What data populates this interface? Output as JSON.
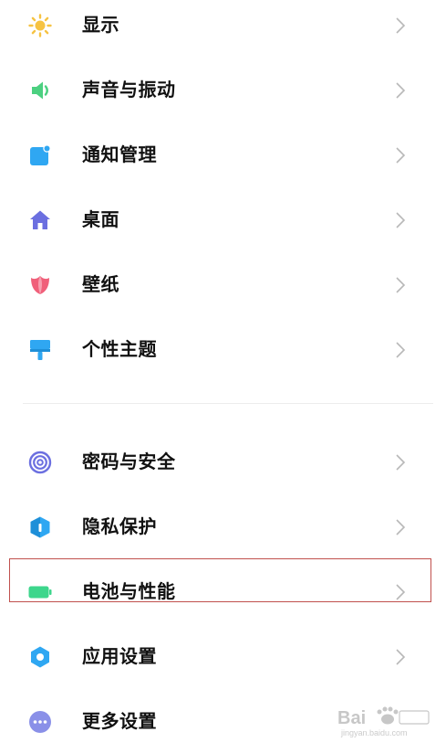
{
  "settings": {
    "items": [
      {
        "label": "显示",
        "icon": "sun-icon",
        "color": "#F6C343"
      },
      {
        "label": "声音与振动",
        "icon": "speaker-icon",
        "color": "#4CD080"
      },
      {
        "label": "通知管理",
        "icon": "notification-icon",
        "color": "#2FA7F2"
      },
      {
        "label": "桌面",
        "icon": "home-icon",
        "color": "#6B6FE0"
      },
      {
        "label": "壁纸",
        "icon": "tulip-icon",
        "color": "#F0607A"
      },
      {
        "label": "个性主题",
        "icon": "paint-brush-icon",
        "color": "#2FA7F2"
      },
      {
        "label": "密码与安全",
        "icon": "fingerprint-icon",
        "color": "#6B6FE0"
      },
      {
        "label": "隐私保护",
        "icon": "privacy-shield-icon",
        "color": "#2FA7F2"
      },
      {
        "label": "电池与性能",
        "icon": "battery-icon",
        "color": "#3DD68C"
      },
      {
        "label": "应用设置",
        "icon": "gear-icon",
        "color": "#2FA7F2"
      },
      {
        "label": "更多设置",
        "icon": "more-dots-icon",
        "color": "#8A90E8"
      }
    ],
    "highlighted_item": "电池与性能"
  },
  "watermark": {
    "brand": "Bai",
    "subtext": "jingyan.baidu.com"
  }
}
